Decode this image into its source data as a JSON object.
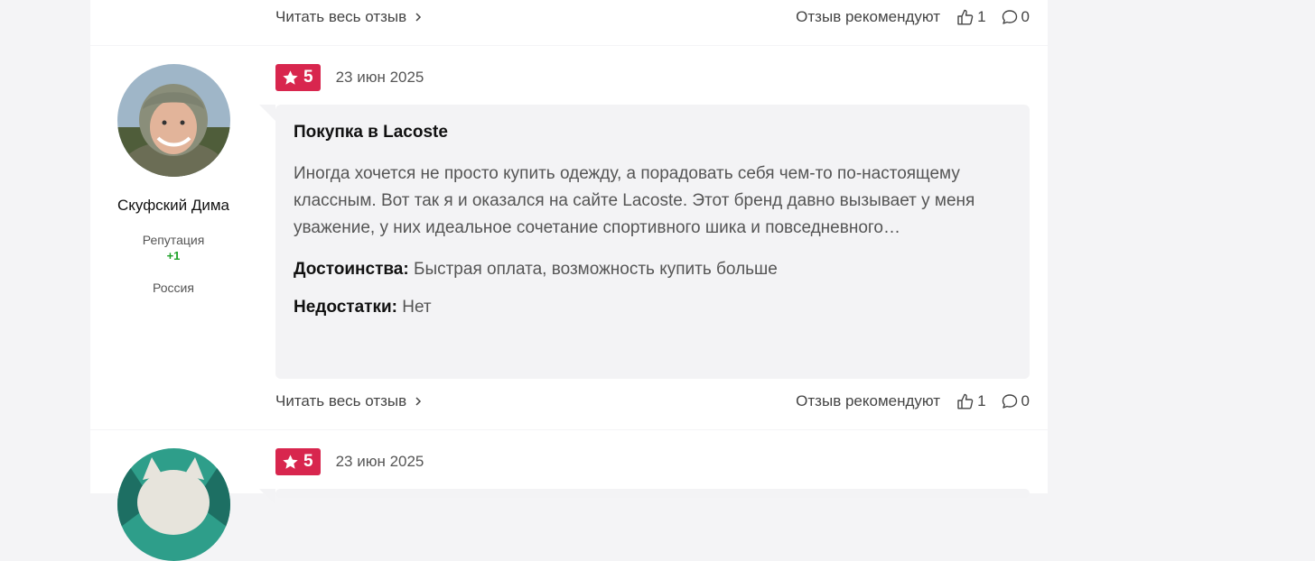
{
  "common": {
    "read_more": "Читать весь отзыв",
    "recommend_label": "Отзыв рекомендуют"
  },
  "review_top": {
    "likes": "1",
    "comments": "0"
  },
  "review_main": {
    "author": {
      "name": "Скуфский Дима",
      "reputation_label": "Репутация",
      "reputation_value": "+1",
      "country": "Россия"
    },
    "rating": "5",
    "date": "23 июн 2025",
    "title": "Покупка в Lacoste",
    "text": "Иногда хочется не просто купить одежду, а порадовать себя чем-то по-настоящему классным. Вот так я и оказался на сайте Lacoste. Этот бренд давно вызывает у меня уважение, у них идеальное сочетание спортивного шика и повседневного…",
    "pros_label": "Достоинства:",
    "pros": "Быстрая оплата, возможность купить больше",
    "cons_label": "Недостатки:",
    "cons": "Нет",
    "likes": "1",
    "comments": "0"
  },
  "review_bottom": {
    "rating": "5",
    "date": "23 июн 2025"
  },
  "colors": {
    "rating_badge": "#d8264e",
    "reputation": "#1fa22a",
    "bubble": "#f3f3f5"
  }
}
